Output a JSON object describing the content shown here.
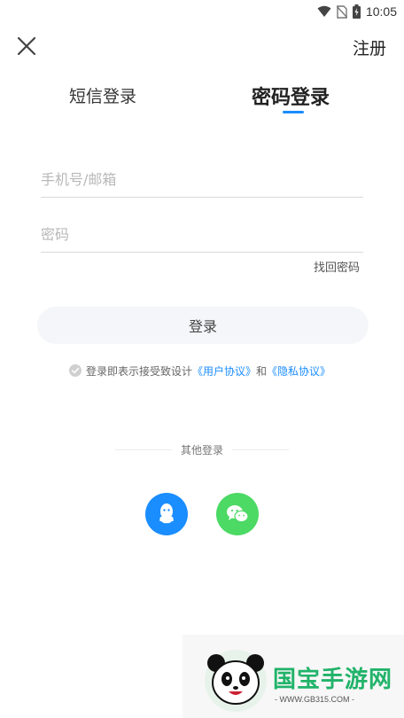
{
  "status_bar": {
    "time": "10:05"
  },
  "header": {
    "register_label": "注册"
  },
  "tabs": [
    {
      "label": "短信登录",
      "active": false
    },
    {
      "label": "密码登录",
      "active": true
    }
  ],
  "form": {
    "phone_placeholder": "手机号/邮箱",
    "password_placeholder": "密码",
    "forgot_label": "找回密码",
    "login_label": "登录"
  },
  "agreement": {
    "prefix": "登录即表示接受致设计",
    "user_agreement": "《用户协议》",
    "connector": "和",
    "privacy_policy": "《隐私协议》"
  },
  "other_login": {
    "label": "其他登录"
  },
  "watermark": {
    "brand": "国宝手游网",
    "url": "- WWW.GB315.COM -"
  },
  "colors": {
    "accent": "#1a8dff",
    "qq": "#1a8dff",
    "wechat": "#4cd964",
    "login_button_bg": "#f4f6f9"
  }
}
